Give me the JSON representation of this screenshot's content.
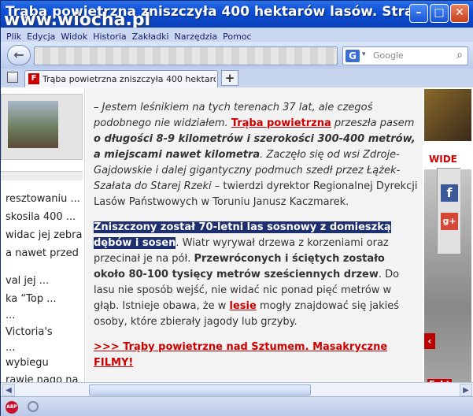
{
  "window": {
    "title": "Trąba powietrzna zniszczyła 400 hektarów lasów. Strat",
    "watermark": "www.wiocha.pl"
  },
  "menu": [
    "Plik",
    "Edycja",
    "Widok",
    "Historia",
    "Zakładki",
    "Narzędzia",
    "Pomoc"
  ],
  "search": {
    "placeholder": "Google",
    "engine_icon": "G"
  },
  "tab": {
    "label": "Trąba powietrzna zniszczyła 400 hektarów l...",
    "favicon": "F"
  },
  "sidebar": {
    "items": [
      "resztowaniu ...",
      "skosila 400 ...",
      "widac jej zebra",
      "a nawet przed",
      "",
      "val jej ...",
      "ka “Top ...",
      "",
      "Victoria's",
      "",
      "wybiegu",
      "rawie nago na"
    ]
  },
  "article": {
    "p1_a": "– Jestem leśnikiem na tych terenach 37 lat, ale czegoś podobnego nie widziałem.",
    "p1_link": "Trąba powietrzna",
    "p1_b": "przeszła pasem",
    "p1_bold": "o długości 8-9 kilometrów i szerokości 300-400 metrów, a miejscami nawet kilometra",
    "p1_c": ". Zaczęło się od wsi Zdroje-Gajdowskie i dalej gigantyczny podmuch szedł przez Łążek-Szałata do Starej Rzeki",
    "p1_d": " – twierdzi dyrektor Regionalnej Dyrekcji Lasów Państwowych w Toruniu Janusz Kaczmarek.",
    "p2_hl": "Zniszczony został 70-letni las sosnowy z domieszką dębów i sosen",
    "p2_a": ". Wiatr wyrywał drzewa z korzeniami oraz przecinał je na pół.",
    "p2_bold": "Przewróconych i ściętych zostało około 80-100 tysięcy metrów sześciennych drzew",
    "p2_b": ". Do lasu nie sposób wejść, nie widać nic ponad pięć metrów w głąb. Istnieje obawa, że w",
    "p2_link": "lesie",
    "p2_c": "mogły znajdować się jakieś osoby, które zbierały jagody lub grzyby.",
    "link": ">>> Trąby powietrzne nad Sztumem. Masakryczne FILMY!"
  },
  "right": {
    "wide_label": "WIDE",
    "fakt": "Fakt"
  },
  "colors": {
    "accent": "#1d2f6e",
    "link": "#c00000",
    "title_bar": "#0c4fd6"
  }
}
